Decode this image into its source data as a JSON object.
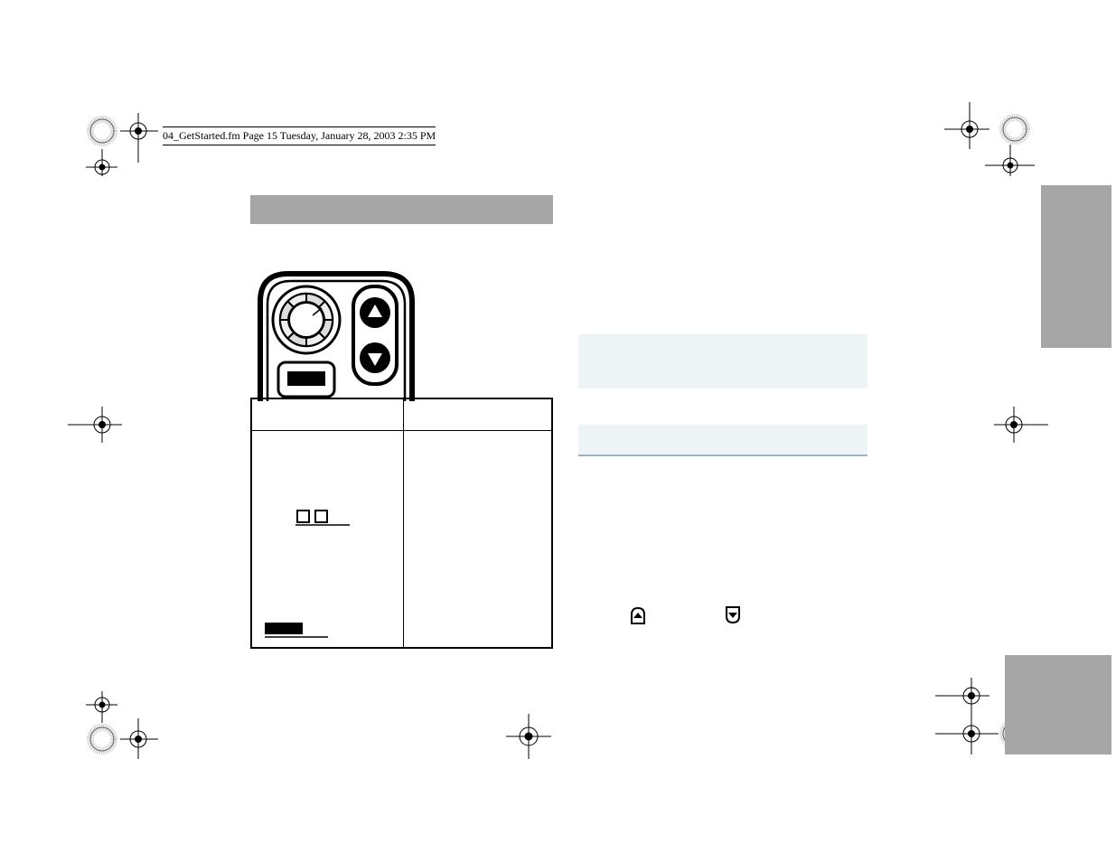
{
  "header": {
    "filename": "04_GetStarted.fm  Page 15  Tuesday, January 28, 2003  2:35 PM"
  }
}
